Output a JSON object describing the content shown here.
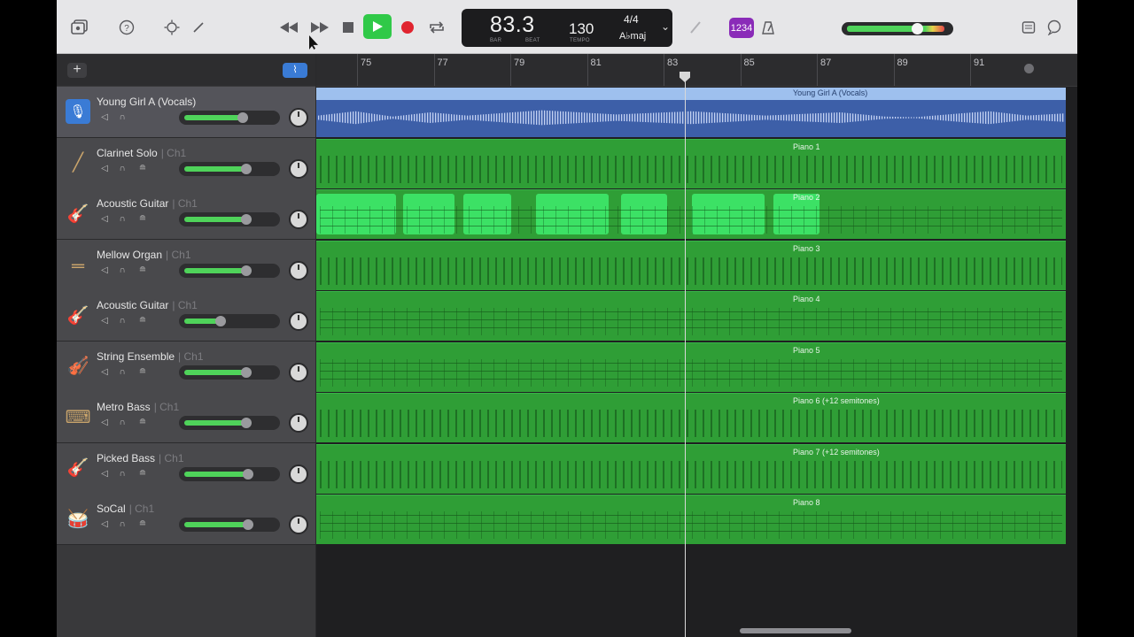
{
  "lcd": {
    "bar_beat": "83.3",
    "bar_label": "BAR",
    "beat_label": "BEAT",
    "tempo": "130",
    "tempo_label": "TEMPO",
    "time_signature": "4/4",
    "key": "A♭maj"
  },
  "toolbar": {
    "count_in_label": "1234",
    "add_track_label": "+"
  },
  "ruler": {
    "bars": [
      "75",
      "77",
      "79",
      "81",
      "83",
      "85",
      "87",
      "89",
      "91"
    ]
  },
  "tracks": [
    {
      "name": "Young Girl A (Vocals)",
      "channel": "",
      "icon": "microphone-icon"
    },
    {
      "name": "Clarinet Solo",
      "channel": "| Ch1",
      "icon": "clarinet-icon"
    },
    {
      "name": "Acoustic Guitar",
      "channel": "| Ch1",
      "icon": "acoustic-guitar-icon"
    },
    {
      "name": "Mellow Organ",
      "channel": "| Ch1",
      "icon": "organ-icon"
    },
    {
      "name": "Acoustic Guitar",
      "channel": "| Ch1",
      "icon": "acoustic-guitar-icon"
    },
    {
      "name": "String Ensemble",
      "channel": "| Ch1",
      "icon": "strings-icon"
    },
    {
      "name": "Metro Bass",
      "channel": "| Ch1",
      "icon": "synth-icon"
    },
    {
      "name": "Picked Bass",
      "channel": "| Ch1",
      "icon": "bass-guitar-icon"
    },
    {
      "name": "SoCal",
      "channel": "| Ch1",
      "icon": "drum-kit-icon"
    }
  ],
  "regions": [
    "Young Girl A (Vocals)",
    "Piano 1",
    "Piano 2",
    "Piano 3",
    "Piano 4",
    "Piano 5",
    "Piano 6 (+12 semitones)",
    "Piano 7 (+12 semitones)",
    "Piano 8"
  ],
  "volumes": [
    0.72,
    0.76,
    0.76,
    0.76,
    0.47,
    0.76,
    0.76,
    0.78,
    0.78
  ],
  "colors": {
    "midi_region": "#2f9e36",
    "audio_region": "#3d5fa8",
    "meter_green": "#4fd35a",
    "record": "#e0242f",
    "play": "#30c948"
  }
}
